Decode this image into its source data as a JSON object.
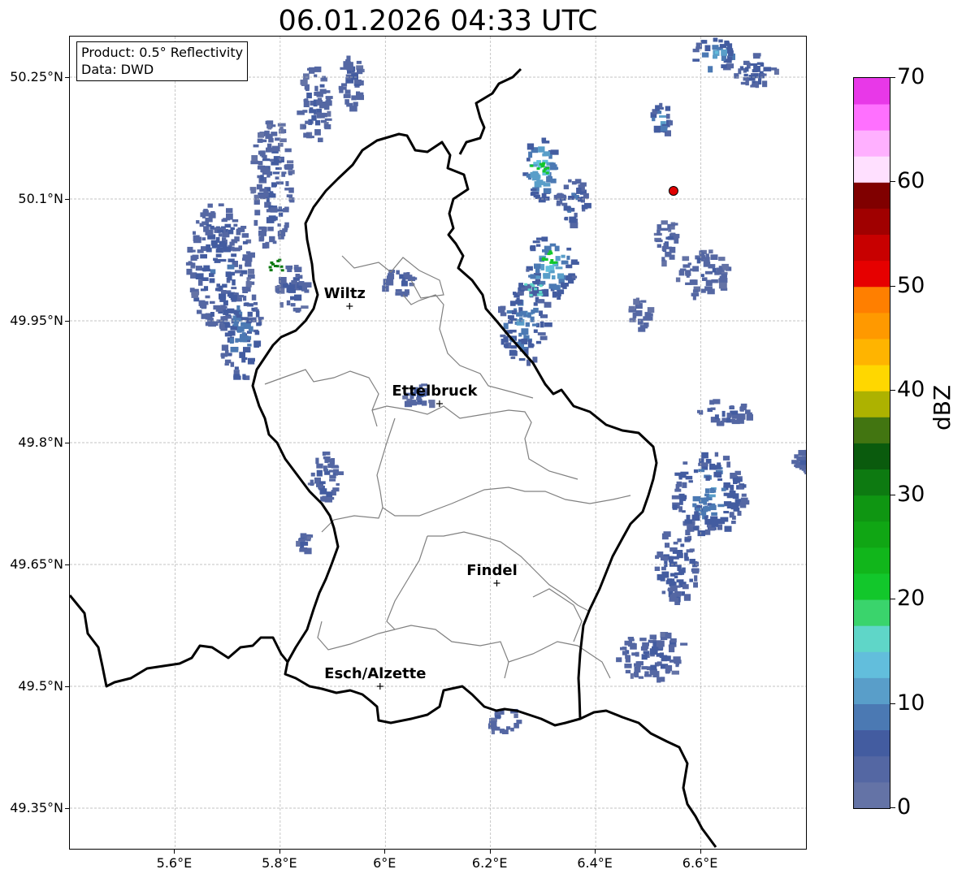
{
  "title": "06.01.2026 04:33 UTC",
  "info_box": {
    "line1": "Product: 0.5° Reflectivity",
    "line2": "Data: DWD"
  },
  "map": {
    "lon_range": [
      5.4,
      6.8
    ],
    "lat_range": [
      49.3,
      50.3
    ],
    "lat_ticks": [
      {
        "value": 50.25,
        "label": "50.25°N"
      },
      {
        "value": 50.1,
        "label": "50.1°N"
      },
      {
        "value": 49.95,
        "label": "49.95°N"
      },
      {
        "value": 49.8,
        "label": "49.8°N"
      },
      {
        "value": 49.65,
        "label": "49.65°N"
      },
      {
        "value": 49.5,
        "label": "49.5°N"
      },
      {
        "value": 49.35,
        "label": "49.35°N"
      }
    ],
    "lon_ticks": [
      {
        "value": 5.6,
        "label": "5.6°E"
      },
      {
        "value": 5.8,
        "label": "5.8°E"
      },
      {
        "value": 6.0,
        "label": "6°E"
      },
      {
        "value": 6.2,
        "label": "6.2°E"
      },
      {
        "value": 6.4,
        "label": "6.4°E"
      },
      {
        "value": 6.6,
        "label": "6.6°E"
      }
    ],
    "gridlines": true,
    "cities": [
      {
        "name": "Wiltz",
        "lon": 5.932,
        "lat": 49.968
      },
      {
        "name": "Ettelbruck",
        "lon": 6.103,
        "lat": 49.848
      },
      {
        "name": "Findel",
        "lon": 6.212,
        "lat": 49.627
      },
      {
        "name": "Esch/Alzette",
        "lon": 5.99,
        "lat": 49.5
      }
    ],
    "radar_site": {
      "lon": 6.548,
      "lat": 50.11,
      "color": "#e00000"
    },
    "border_color": "#000000",
    "district_color": "#808080"
  },
  "colorbar": {
    "label": "dBZ",
    "min": 0,
    "max": 70,
    "step": 2.5,
    "tick_labels": [
      {
        "value": 0,
        "label": "0"
      },
      {
        "value": 10,
        "label": "10"
      },
      {
        "value": 20,
        "label": "20"
      },
      {
        "value": 30,
        "label": "30"
      },
      {
        "value": 40,
        "label": "40"
      },
      {
        "value": 50,
        "label": "50"
      },
      {
        "value": 60,
        "label": "60"
      },
      {
        "value": 70,
        "label": "70"
      }
    ],
    "colors": [
      "#6473a6",
      "#5467a3",
      "#435ca0",
      "#4b79b3",
      "#599ec9",
      "#62bedc",
      "#5fd6c8",
      "#3ad46c",
      "#12c72b",
      "#11b61b",
      "#10a614",
      "#0f9612",
      "#0d7a11",
      "#0a5b0d",
      "#427511",
      "#adb200",
      "#ffd700",
      "#ffb400",
      "#ff9900",
      "#ff7f00",
      "#e60000",
      "#c80000",
      "#a00000",
      "#800000",
      "#ffe0ff",
      "#ffb0ff",
      "#ff70ff",
      "#e838e8"
    ]
  },
  "precip_cells": [
    {
      "lon": 5.68,
      "lat": 50.02,
      "rx": 0.06,
      "ry": 0.08,
      "dbz": 6
    },
    {
      "lon": 5.72,
      "lat": 49.94,
      "rx": 0.04,
      "ry": 0.06,
      "dbz": 8
    },
    {
      "lon": 5.78,
      "lat": 50.12,
      "rx": 0.04,
      "ry": 0.08,
      "dbz": 5
    },
    {
      "lon": 5.86,
      "lat": 50.22,
      "rx": 0.03,
      "ry": 0.05,
      "dbz": 4
    },
    {
      "lon": 5.82,
      "lat": 49.99,
      "rx": 0.03,
      "ry": 0.03,
      "dbz": 5
    },
    {
      "lon": 5.93,
      "lat": 50.25,
      "rx": 0.02,
      "ry": 0.04,
      "dbz": 4
    },
    {
      "lon": 6.02,
      "lat": 50.0,
      "rx": 0.03,
      "ry": 0.015,
      "dbz": 5
    },
    {
      "lon": 6.06,
      "lat": 49.86,
      "rx": 0.03,
      "ry": 0.015,
      "dbz": 5
    },
    {
      "lon": 5.88,
      "lat": 49.76,
      "rx": 0.03,
      "ry": 0.03,
      "dbz": 6
    },
    {
      "lon": 5.84,
      "lat": 49.68,
      "rx": 0.015,
      "ry": 0.015,
      "dbz": 4
    },
    {
      "lon": 6.29,
      "lat": 50.14,
      "rx": 0.03,
      "ry": 0.04,
      "dbz": 14
    },
    {
      "lon": 6.35,
      "lat": 50.1,
      "rx": 0.03,
      "ry": 0.03,
      "dbz": 7
    },
    {
      "lon": 6.31,
      "lat": 50.02,
      "rx": 0.045,
      "ry": 0.04,
      "dbz": 13
    },
    {
      "lon": 6.26,
      "lat": 49.95,
      "rx": 0.05,
      "ry": 0.05,
      "dbz": 9
    },
    {
      "lon": 6.48,
      "lat": 49.96,
      "rx": 0.02,
      "ry": 0.02,
      "dbz": 4
    },
    {
      "lon": 6.53,
      "lat": 50.05,
      "rx": 0.02,
      "ry": 0.03,
      "dbz": 4
    },
    {
      "lon": 6.6,
      "lat": 50.01,
      "rx": 0.05,
      "ry": 0.03,
      "dbz": 4
    },
    {
      "lon": 6.52,
      "lat": 50.2,
      "rx": 0.02,
      "ry": 0.02,
      "dbz": 10
    },
    {
      "lon": 6.62,
      "lat": 50.28,
      "rx": 0.04,
      "ry": 0.02,
      "dbz": 12
    },
    {
      "lon": 6.7,
      "lat": 50.26,
      "rx": 0.04,
      "ry": 0.02,
      "dbz": 6
    },
    {
      "lon": 6.61,
      "lat": 49.74,
      "rx": 0.07,
      "ry": 0.05,
      "dbz": 9
    },
    {
      "lon": 6.55,
      "lat": 49.65,
      "rx": 0.04,
      "ry": 0.05,
      "dbz": 6
    },
    {
      "lon": 6.5,
      "lat": 49.54,
      "rx": 0.07,
      "ry": 0.03,
      "dbz": 5
    },
    {
      "lon": 6.64,
      "lat": 49.84,
      "rx": 0.05,
      "ry": 0.015,
      "dbz": 5
    },
    {
      "lon": 6.79,
      "lat": 49.78,
      "rx": 0.02,
      "ry": 0.015,
      "dbz": 4
    },
    {
      "lon": 6.22,
      "lat": 49.46,
      "rx": 0.03,
      "ry": 0.015,
      "dbz": 4
    }
  ],
  "precip_hotspots": [
    {
      "lon": 6.29,
      "lat": 50.14,
      "dbz": 22
    },
    {
      "lon": 6.31,
      "lat": 50.03,
      "dbz": 22
    },
    {
      "lon": 6.28,
      "lat": 49.99,
      "dbz": 15
    },
    {
      "lon": 5.79,
      "lat": 50.02,
      "dbz": 30
    }
  ]
}
